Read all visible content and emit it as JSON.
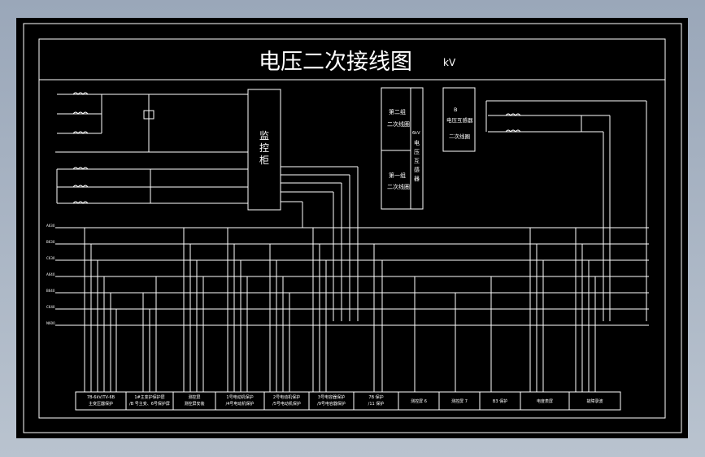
{
  "viewport": {
    "background": "#000000",
    "line_color": "#ffffff",
    "frame_bg": "#9aa7b9"
  },
  "drawing": {
    "title": "电压二次接线图",
    "title_overlap": "kV",
    "control_cabinet": "监控柜",
    "secondary_box": {
      "upper": [
        "第二组",
        "二次线圈"
      ],
      "lower": [
        "第一组",
        "二次线圈"
      ],
      "side": [
        "电压互感器"
      ],
      "side_prefix": "6kV"
    },
    "transformer_box": {
      "lines": [
        "电压互感器",
        "二次线圈"
      ],
      "prefix": "B"
    },
    "bus_labels": [
      "A630",
      "B630",
      "C630",
      "A640",
      "B640",
      "C640",
      "N600"
    ],
    "bottom_labels": [
      [
        "7B-6kV/TV-6B",
        "主变压器保护"
      ],
      [
        "1#主变护保护屏",
        "/B 号主变、6号保护屏"
      ],
      [
        "测控屏",
        "测控屏安装"
      ],
      [
        "1号电动机保护",
        "/4号电动机保护"
      ],
      [
        "2号电动机保护",
        "/5号电动机保护"
      ],
      [
        "3号电容器保护",
        "/9号电容器保护"
      ],
      [
        "7B 保护",
        "/11 保护"
      ],
      [
        "测控屏 6"
      ],
      [
        "测控屏 7"
      ],
      [
        "B3 保护"
      ],
      [
        "电度表屏"
      ],
      [
        "故障录波"
      ]
    ]
  }
}
